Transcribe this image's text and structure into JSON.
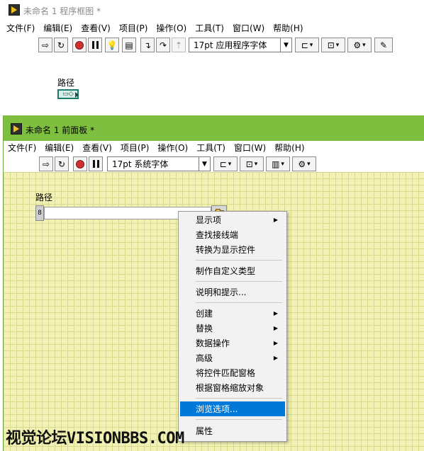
{
  "block_diagram": {
    "title": "未命名 1 程序框图 *",
    "menu": [
      "文件(F)",
      "编辑(E)",
      "查看(V)",
      "项目(P)",
      "操作(O)",
      "工具(T)",
      "窗口(W)",
      "帮助(H)"
    ],
    "font_selector": "17pt 应用程序字体",
    "terminal_label": "路径"
  },
  "front_panel": {
    "title": "未命名 1 前面板 *",
    "menu": [
      "文件(F)",
      "编辑(E)",
      "查看(V)",
      "项目(P)",
      "操作(O)",
      "工具(T)",
      "窗口(W)",
      "帮助(H)"
    ],
    "font_selector": "17pt 系统字体",
    "control_label": "路径",
    "path_value": ""
  },
  "context_menu": {
    "items": [
      {
        "label": "显示项",
        "submenu": true
      },
      {
        "label": "查找接线端",
        "submenu": false
      },
      {
        "label": "转换为显示控件",
        "submenu": false
      },
      {
        "label": "制作自定义类型",
        "submenu": false
      },
      {
        "label": "说明和提示...",
        "submenu": false
      },
      {
        "label": "创建",
        "submenu": true
      },
      {
        "label": "替换",
        "submenu": true
      },
      {
        "label": "数据操作",
        "submenu": true
      },
      {
        "label": "高级",
        "submenu": true
      },
      {
        "label": "将控件匹配窗格",
        "submenu": false
      },
      {
        "label": "根据窗格缩放对象",
        "submenu": false
      },
      {
        "label": "浏览选项...",
        "submenu": false,
        "highlighted": true
      },
      {
        "label": "属性",
        "submenu": false
      }
    ]
  },
  "watermark": "视觉论坛VISIONBBS.COM",
  "colors": {
    "front_panel_titlebar": "#7fbf3f",
    "panel_grid_bg": "#f2f2b6",
    "menu_highlight": "#0078d7"
  }
}
